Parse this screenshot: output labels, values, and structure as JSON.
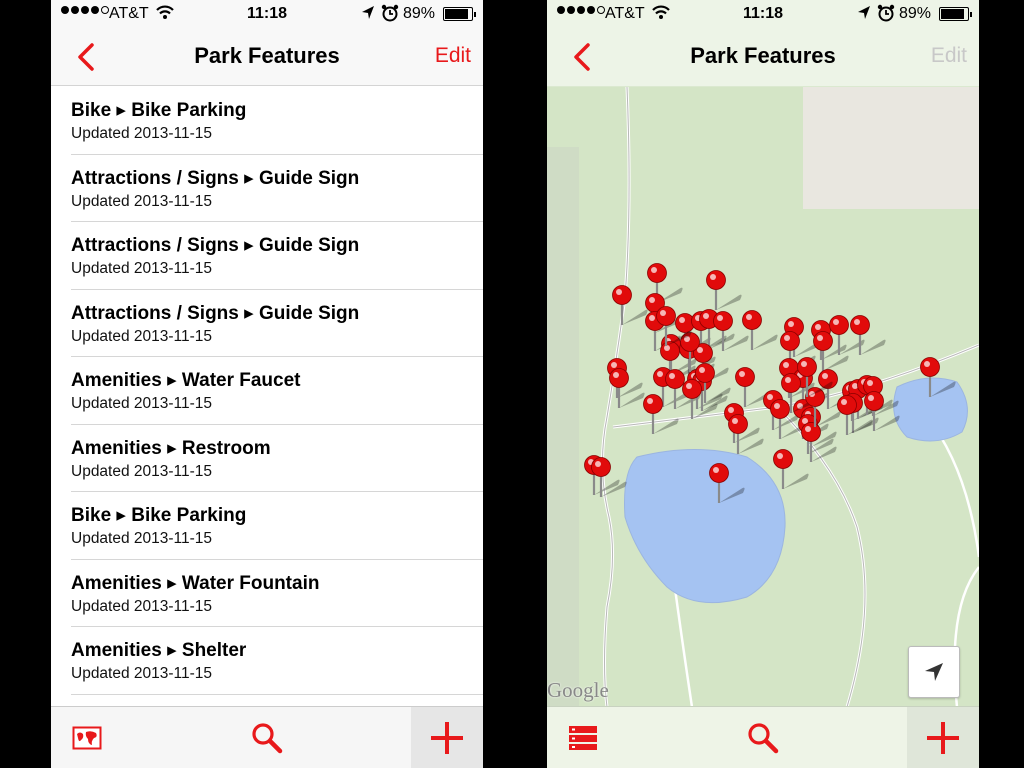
{
  "status": {
    "carrier": "AT&T",
    "time": "11:18",
    "battery_pct": "89%",
    "battery_level": 0.89,
    "signal_bars_filled": 4,
    "signal_bars_total": 5
  },
  "accent_color": "#e8191b",
  "left": {
    "title": "Park Features",
    "edit_label": "Edit",
    "edit_color": "#e8191b",
    "rows": [
      {
        "title": "Bike ▸ Bike Parking",
        "subtitle": "Updated 2013-11-15"
      },
      {
        "title": "Attractions / Signs ▸ Guide Sign",
        "subtitle": "Updated 2013-11-15"
      },
      {
        "title": "Attractions / Signs ▸ Guide Sign",
        "subtitle": "Updated 2013-11-15"
      },
      {
        "title": "Attractions / Signs ▸ Guide Sign",
        "subtitle": "Updated 2013-11-15"
      },
      {
        "title": "Amenities ▸ Water Faucet",
        "subtitle": "Updated 2013-11-15"
      },
      {
        "title": "Amenities ▸ Restroom",
        "subtitle": "Updated 2013-11-15"
      },
      {
        "title": "Bike ▸ Bike Parking",
        "subtitle": "Updated 2013-11-15"
      },
      {
        "title": "Amenities ▸ Water Fountain",
        "subtitle": "Updated 2013-11-15"
      },
      {
        "title": "Amenities ▸ Shelter",
        "subtitle": "Updated 2013-11-15"
      }
    ],
    "toolbar": [
      "map-icon",
      "search-icon",
      "add-icon"
    ]
  },
  "right": {
    "title": "Park Features",
    "edit_label": "Edit",
    "edit_color": "#c8c8c8",
    "attribution": "Google",
    "pin_count": 58,
    "toolbar": [
      "list-icon",
      "search-icon",
      "add-icon"
    ]
  }
}
